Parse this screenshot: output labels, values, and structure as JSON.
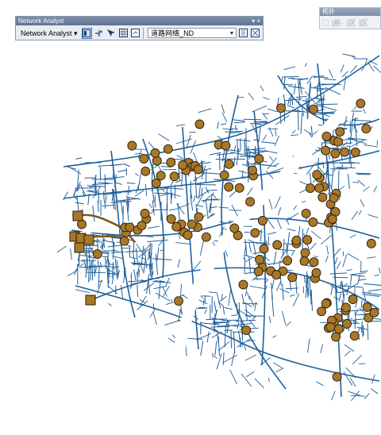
{
  "toolbar": {
    "title": "Network Analyst",
    "title_buttons": "▾ ×",
    "menu_label": "Network Analyst ▾",
    "network_dataset": "道路网络_ND"
  },
  "topology_toolbar": {
    "title": "拓扑",
    "buttons": [
      "⬚",
      "|卧·",
      "|区",
      "|区"
    ]
  },
  "colors": {
    "road": "#1f5f9a",
    "facility_fill": "#a8782a",
    "route": "#7a5a1a",
    "toolbar_bg": "#e9edf3"
  },
  "map": {
    "facility_count": 120
  }
}
